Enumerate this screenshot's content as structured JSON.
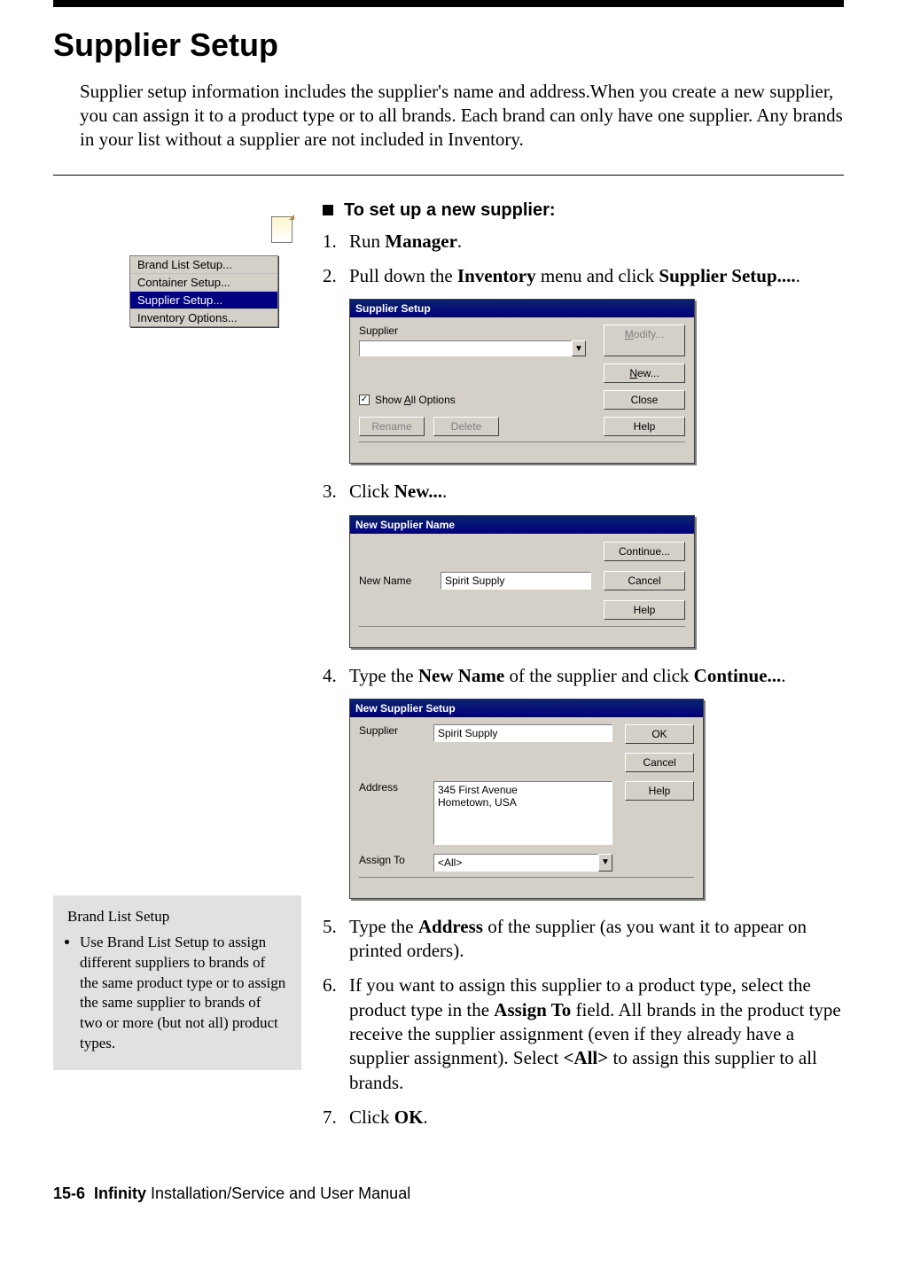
{
  "header": {
    "title": "Supplier Setup"
  },
  "intro": "Supplier setup information includes the supplier's name and address.When you create a new supplier, you can assign it to a product type or to all brands. Each brand can only have one supplier. Any brands in your list without a supplier are not included in Inventory.",
  "task_heading": "To set up a new supplier:",
  "steps": {
    "s1": {
      "num": "1.",
      "a": "Run ",
      "b": "Manager",
      "c": "."
    },
    "s2": {
      "num": "2.",
      "a": "Pull down the ",
      "b": "Inventory",
      "c": " menu and click ",
      "d": "Supplier Setup....",
      "e": "."
    },
    "s3": {
      "num": "3.",
      "a": "Click ",
      "b": "New...",
      "c": "."
    },
    "s4": {
      "num": "4.",
      "a": "Type the ",
      "b": "New Name",
      "c": " of the supplier and click ",
      "d": "Continue...",
      "e": "."
    },
    "s5": {
      "num": "5.",
      "a": "Type the ",
      "b": "Address",
      "c": " of the supplier (as you want it to appear on printed orders)."
    },
    "s6": {
      "num": "6.",
      "a": "If you want to assign this supplier to a product type, select the product type in the ",
      "b": "Assign To",
      "c": " field. All brands in the product type receive the supplier assignment (even if they already have a supplier assignment). Select ",
      "d": "<All>",
      "e": " to assign this supplier to all brands."
    },
    "s7": {
      "num": "7.",
      "a": "Click ",
      "b": "OK",
      "c": "."
    }
  },
  "menu": {
    "items": {
      "i0": "Brand List Setup...",
      "i1": "Container Setup...",
      "i2": "Supplier Setup...",
      "i3": "Inventory Options..."
    }
  },
  "dlg1": {
    "title": "Supplier Setup",
    "supplier_label": "Supplier",
    "show_all": "Show All Options",
    "modify": "Modify...",
    "new": "New...",
    "close": "Close",
    "rename": "Rename",
    "delete": "Delete",
    "help": "Help"
  },
  "dlg2": {
    "title": "New Supplier Name",
    "new_name_label": "New Name",
    "new_name_value": "Spirit Supply",
    "continue": "Continue...",
    "cancel": "Cancel",
    "help": "Help"
  },
  "dlg3": {
    "title": "New Supplier Setup",
    "supplier_label": "Supplier",
    "supplier_value": "Spirit Supply",
    "address_label": "Address",
    "address_value": "345 First Avenue\nHometown, USA",
    "assign_label": "Assign To",
    "assign_value": "<All>",
    "ok": "OK",
    "cancel": "Cancel",
    "help": "Help"
  },
  "sidebar": {
    "title": "Brand List Setup",
    "body": "Use Brand List Setup to assign different suppliers to brands of the same product type or to assign the same supplier to brands of two or more (but not all) product types."
  },
  "footer": {
    "page": "15-6",
    "product": "Infinity",
    "rest": " Installation/Service and User Manual"
  }
}
